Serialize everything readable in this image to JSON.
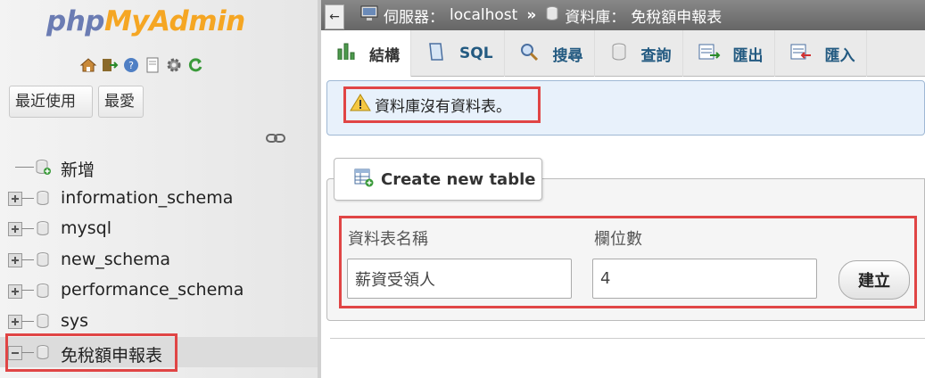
{
  "app": {
    "logo_part1": "php",
    "logo_part2": "MyAdmin"
  },
  "colors": {
    "highlight": "#e04545",
    "link": "#235a81",
    "topbar": "#777777",
    "notice_bg": "#e8f1fb",
    "logo_blue": "#6b7cb3",
    "logo_orange": "#f5a623"
  },
  "left_panel": {
    "quick_icons": [
      "home-icon",
      "logout-icon",
      "help-icon",
      "docs-icon",
      "settings-icon",
      "reload-icon"
    ],
    "buttons": {
      "recent": "最近使用",
      "favorites": "最愛"
    },
    "link_icon": "link-chain-icon",
    "tree": [
      {
        "label": "新增",
        "type": "new"
      },
      {
        "label": "information_schema",
        "type": "db"
      },
      {
        "label": "mysql",
        "type": "db"
      },
      {
        "label": "new_schema",
        "type": "db"
      },
      {
        "label": "performance_schema",
        "type": "db"
      },
      {
        "label": "sys",
        "type": "db"
      },
      {
        "label": "免稅額申報表",
        "type": "db-selected"
      }
    ]
  },
  "breadcrumb": {
    "collapse": "←",
    "server_label": "伺服器：",
    "server_value": "localhost",
    "separator": "»",
    "db_label": "資料庫：",
    "db_value": "免稅額申報表"
  },
  "tabs": [
    {
      "label": "結構",
      "icon": "structure-icon"
    },
    {
      "label": "SQL",
      "icon": "sql-icon"
    },
    {
      "label": "搜尋",
      "icon": "search-icon"
    },
    {
      "label": "查詢",
      "icon": "query-icon"
    },
    {
      "label": "匯出",
      "icon": "export-icon"
    },
    {
      "label": "匯入",
      "icon": "import-icon"
    }
  ],
  "notice": {
    "text": "資料庫沒有資料表。",
    "icon": "warning-icon"
  },
  "create_table": {
    "legend": "Create new table",
    "name_label": "資料表名稱",
    "name_value": "薪資受領人",
    "cols_label": "欄位數",
    "cols_value": "4",
    "submit": "建立"
  }
}
